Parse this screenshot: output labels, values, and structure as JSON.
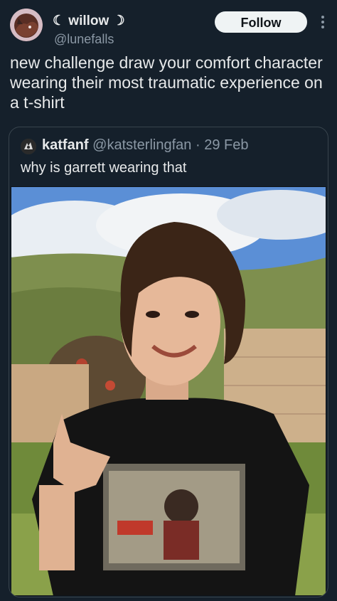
{
  "author": {
    "display_name": "☾ willow ☽",
    "handle": "@lunefalls"
  },
  "follow_label": "Follow",
  "tweet": {
    "text": "new challenge draw your comfort character wearing their most traumatic experience on a t-shirt"
  },
  "quote": {
    "name": "katfanf",
    "handle": "@katsterlingfan",
    "separator": "·",
    "date": "29 Feb",
    "text": "why is garrett wearing that"
  },
  "icons": {
    "more": "more-vertical-icon"
  },
  "colors": {
    "background": "#15202b",
    "primary_text": "#e7e9ea",
    "secondary_text": "#8b98a5",
    "border": "#38444d",
    "follow_bg": "#eff3f4"
  }
}
